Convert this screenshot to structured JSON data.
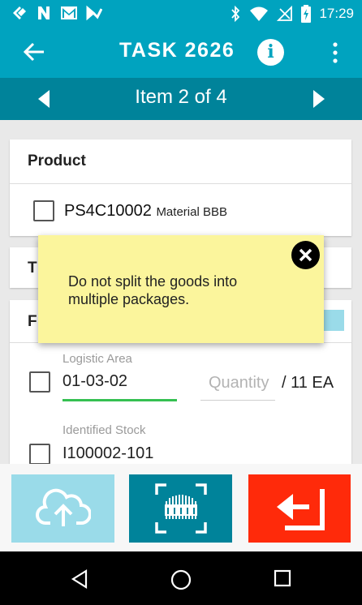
{
  "status_bar": {
    "time": "17:29",
    "icons": [
      "flipboard-icon",
      "n-icon",
      "gmail-icon",
      "tasks-icon",
      "bluetooth-icon",
      "wifi-icon",
      "no-signal-icon",
      "battery-charging-icon"
    ]
  },
  "app_bar": {
    "title": "TASK 2626",
    "info_label": "i"
  },
  "item_nav": {
    "label": "Item 2 of 4"
  },
  "product_card": {
    "header": "Product",
    "product_code": "PS4C10002",
    "product_description": "Material BBB"
  },
  "second_card": {
    "header_initial": "T"
  },
  "third_card": {
    "header_initial": "F",
    "logistic_area_label": "Logistic Area",
    "logistic_area_value": "01-03-02",
    "quantity_placeholder": "Quantity",
    "quantity_suffix": "/ 11 EA",
    "identified_stock_label": "Identified Stock",
    "identified_stock_value": "I100002-101"
  },
  "popup": {
    "message": "Do not split the goods into multiple packages."
  },
  "colors": {
    "primary": "#00a3bf",
    "primary_dark": "#00839a",
    "upload_disabled": "#9adbe9",
    "return_red": "#ff2a0a",
    "popup_yellow": "#fbf59c",
    "underline_green": "#35c051"
  }
}
